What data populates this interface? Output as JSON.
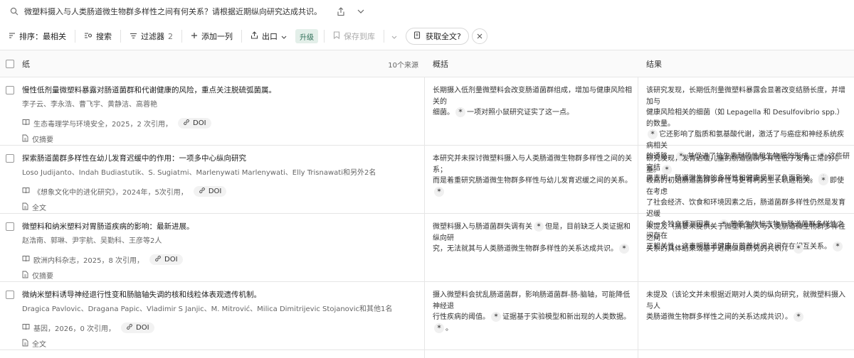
{
  "query": "微塑料摄入与人类肠道微生物群多样性之间有何关系？请根据近期纵向研究达成共识。",
  "toolbar": {
    "sort": "排序：最相关",
    "search": "搜索",
    "filters": "过滤器",
    "filter_count": "2",
    "add_column": "添加一列",
    "export": "出口",
    "upgrade": "升级",
    "save_to_library": "保存到库",
    "get_full_text": "获取全文?"
  },
  "table": {
    "col_paper": "纸",
    "source_count": "10个来源",
    "col_summary": "概括",
    "col_results": "结果",
    "rows": [
      {
        "title": "慢性低剂量微塑料暴露对肠道菌群和代谢健康的风险，重点关注脱硫弧菌属。",
        "authors": "李子云、李永浩、曹飞宇、黄静洁、高蓉艳",
        "meta": "生态毒理学与环境安全，2025，2 次引用，",
        "doi": "DOI",
        "access": "仅摘要",
        "summary": [
          "长期摄入低剂量微塑料会改变肠道菌群组成，增加与健康风险相关的",
          "细菌。",
          "一项对照小鼠研究证实了这一点。"
        ],
        "results": [
          "该研究发现，长期低剂量微塑料暴露会显著改变结肠长度，并增加与",
          "健康风险相关的细菌（如 Lepagella 和 Desulfovibrio spp.）的数量。",
          "它还影响了脂质和氨基酸代谢，激活了与癌症和神经系统疾病相关",
          "的通路。",
          "并促进了抗生素耐药性和生物膜的形成。",
          "这些研究结",
          "果表明，肠道微生物的多样性和健康受到了负面影响。"
        ]
      },
      {
        "title": "探索肠道菌群多样性在幼儿发育迟缓中的作用：一项多中心纵向研究",
        "authors": "Loso Judijanto、Indah Budiastutik、S. Sugiatmi、Marlenywati Marlenywati、Elly Trisnawati和另外2名",
        "meta": "《想象文化中的进化研究》，2024年，5次引用，",
        "doi": "DOI",
        "access": "全文",
        "summary": [
          "本研究并未探讨微塑料摄入与人类肠道微生物群多样性之间的关系；",
          "而是着重研究肠道微生物群多样性与幼儿发育迟缓之间的关系。"
        ],
        "results": [
          "研究发现，发育迟缓儿童的肠道菌群多样性低于发育正常的儿童。",
          "较高的初始肠道菌群多样性与更有利的生长轨迹相关。",
          "即使在考虑",
          "了社会经济、饮食和环境因素之后，肠道菌群多样性仍然是发育迟缓",
          "的一个独立预测因素。",
          "营养生物标志物与肠道菌群多样性之间存在",
          "正相关性，这表明肠道健康与营养状况之间存在相互关系。"
        ]
      },
      {
        "title": "微塑料和纳米塑料对胃肠道疾病的影响：最新进展。",
        "authors": "赵浩南、郭琳、尹宇航、吴勤科、王彦等2人",
        "meta": "欧洲内科杂志，2025，8 次引用，",
        "doi": "DOI",
        "access": "仅摘要",
        "summary": [
          "微塑料摄入与肠道菌群失调有关",
          "但是，目前缺乏人类证据和纵向研",
          "究，无法就其与人类肠道微生物群多样性的关系达成共识。"
        ],
        "results": [
          "未提及（摘要未提供关于微塑料摄入与人类肠道微生物群多样性之间",
          "关系的具体结果或基于近期纵向研究的共识）。"
        ]
      },
      {
        "title": "微纳米塑料诱导神经退行性变和肠脑轴失调的核和线粒体表观遗传机制。",
        "authors": "Dragica Pavlovic、Dragana Papic、Vladimir S Janjic、M. Mitrović、Milica Dimitrijevic Stojanovic和其他1名",
        "meta": "基因，2026，0 次引用，",
        "doi": "DOI",
        "access": "全文",
        "summary": [
          "摄入微塑料会扰乱肠道菌群，影响肠道菌群-肠-脑轴，可能降低神经退",
          "行性疾病的阈值。",
          "证据基于实验模型和新出现的人类数据。"
        ],
        "results": [
          "未提及（该论文并未根据近期对人类的纵向研究，就微塑料摄入与人",
          "类肠道微生物群多样性之间的关系达成共识）。"
        ]
      }
    ]
  },
  "icons": [
    "search-icon",
    "share-icon",
    "chevron-down-icon",
    "sort-icon",
    "search-list-icon",
    "filter-icon",
    "plus-icon",
    "export-icon",
    "save-icon",
    "fulltext-icon",
    "close-icon",
    "book-icon",
    "doc-icon",
    "link-icon"
  ]
}
